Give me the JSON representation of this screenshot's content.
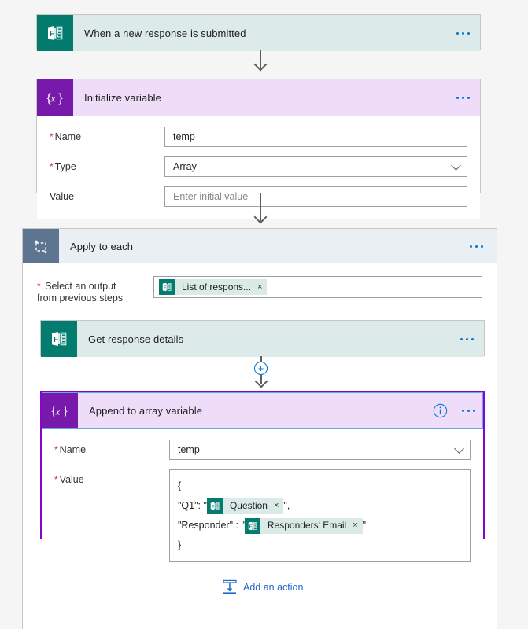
{
  "canvas": {
    "background": "#f5f5f5",
    "accent_blue": "#0078d4",
    "selection_purple": "#8406c9"
  },
  "cards": {
    "trigger": {
      "title": "When a new response is submitted",
      "icon": "microsoft-forms-icon",
      "icon_color": "#037b6e",
      "header_color": "#dcebe9",
      "menu_label": "..."
    },
    "initialize_variable": {
      "title": "Initialize variable",
      "icon": "variable-braces-icon",
      "icon_color": "#7719aa",
      "header_color": "#eedcf8",
      "menu_label": "...",
      "fields": {
        "name_label": "Name",
        "name_value": "temp",
        "type_label": "Type",
        "type_value": "Array",
        "value_label": "Value",
        "value_placeholder": "Enter initial value"
      }
    },
    "apply_to_each": {
      "title": "Apply to each",
      "icon": "loop-icon",
      "icon_color": "#5e7592",
      "header_color": "#eaeff4",
      "menu_label": "...",
      "select_output_label_line1": "Select an output",
      "select_output_label_line2": "from previous steps",
      "token": {
        "label": "List of respons...",
        "icon": "microsoft-forms-icon",
        "remove_label": "×"
      }
    },
    "get_response_details": {
      "title": "Get response details",
      "icon": "microsoft-forms-icon",
      "icon_color": "#037b6e",
      "header_color": "#dcebe9",
      "menu_label": "..."
    },
    "append_to_array": {
      "title": "Append to array variable",
      "icon": "variable-braces-icon",
      "icon_color": "#7719aa",
      "header_color": "#eedcf8",
      "info_label": "i",
      "menu_label": "...",
      "selected": true,
      "fields": {
        "name_label": "Name",
        "name_value": "temp",
        "value_label": "Value",
        "value_lines": {
          "line1": "{",
          "line2_prefix": "\"Q1\": \"",
          "line2_token": "Question",
          "line2_suffix": "\",",
          "line3_prefix": "\"Responder\" : \"",
          "line3_token": "Responders' Email",
          "line3_suffix": "\"",
          "line4": "}"
        },
        "token_remove_label": "×"
      }
    }
  },
  "add_action": {
    "label": "Add an action",
    "icon": "insert-action-icon"
  },
  "insert_button": {
    "label": "+",
    "name": "insert-step-button"
  }
}
